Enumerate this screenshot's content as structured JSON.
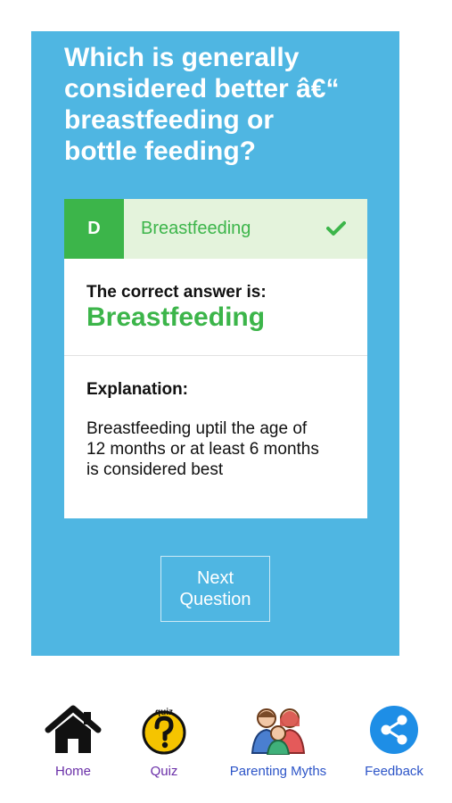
{
  "question": {
    "line1": "Which is generally",
    "line2": "considered better â€“",
    "line3": "breastfeeding or",
    "line4": "bottle feeding?"
  },
  "selected_choice": {
    "letter": "D",
    "text": "Breastfeeding",
    "status_icon": "checkmark-icon"
  },
  "result": {
    "label": "The correct answer is:",
    "answer": "Breastfeeding"
  },
  "explanation": {
    "heading": "Explanation:",
    "line1": "Breastfeeding uptil the age of",
    "line2": "12 months or at least 6 months",
    "line3": "is considered best"
  },
  "next_button": {
    "line1": "Next",
    "line2": "Question"
  },
  "tabs": [
    {
      "label": "Home",
      "icon": "house-icon"
    },
    {
      "label": "Quiz",
      "icon": "quiz-question-icon"
    },
    {
      "label": "Parenting Myths",
      "icon": "family-icon"
    },
    {
      "label": "Feedback",
      "icon": "share-icon"
    }
  ],
  "colors": {
    "card_blue": "#4fb6e2",
    "correct_green": "#3cb54a",
    "correct_row_bg": "#e4f3dc",
    "tab_label_purple": "#6a2fa8",
    "tab_label_blue": "#2d55c8"
  }
}
